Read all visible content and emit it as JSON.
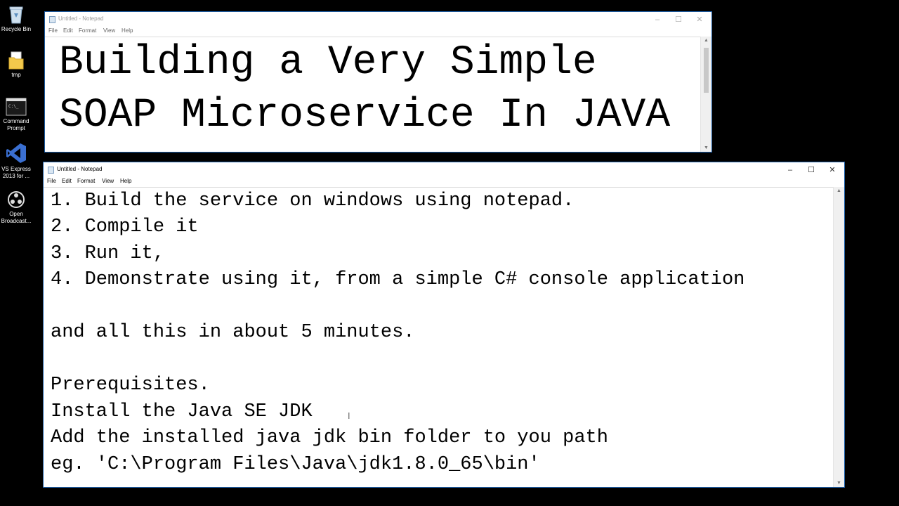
{
  "desktop": {
    "icons": [
      {
        "label": "Recycle Bin",
        "icon": "recycle-bin-icon"
      },
      {
        "label": "tmp",
        "icon": "folder-icon"
      },
      {
        "label": "Command Prompt",
        "icon": "command-prompt-icon"
      },
      {
        "label": "VS Express 2013 for ...",
        "icon": "visual-studio-icon"
      },
      {
        "label": "Open Broadcast...",
        "icon": "obs-icon"
      }
    ]
  },
  "window_top": {
    "title": "Untitled - Notepad",
    "menu": [
      "File",
      "Edit",
      "Format",
      "View",
      "Help"
    ],
    "lines": [
      "Building a Very Simple",
      "SOAP Microservice In JAVA"
    ]
  },
  "window_bottom": {
    "title": "Untitled - Notepad",
    "menu": [
      "File",
      "Edit",
      "Format",
      "View",
      "Help"
    ],
    "lines": [
      "1. Build the service on windows using notepad.",
      "2. Compile it",
      "3. Run it,",
      "4. Demonstrate using it, from a simple C# console application",
      "",
      "and all this in about 5 minutes.",
      "",
      "Prerequisites.",
      "Install the Java SE JDK",
      "Add the installed java jdk bin folder to you path",
      "eg. 'C:\\Program Files\\Java\\jdk1.8.0_65\\bin'"
    ]
  },
  "window_controls": {
    "minimize": "–",
    "maximize": "☐",
    "close": "✕"
  }
}
